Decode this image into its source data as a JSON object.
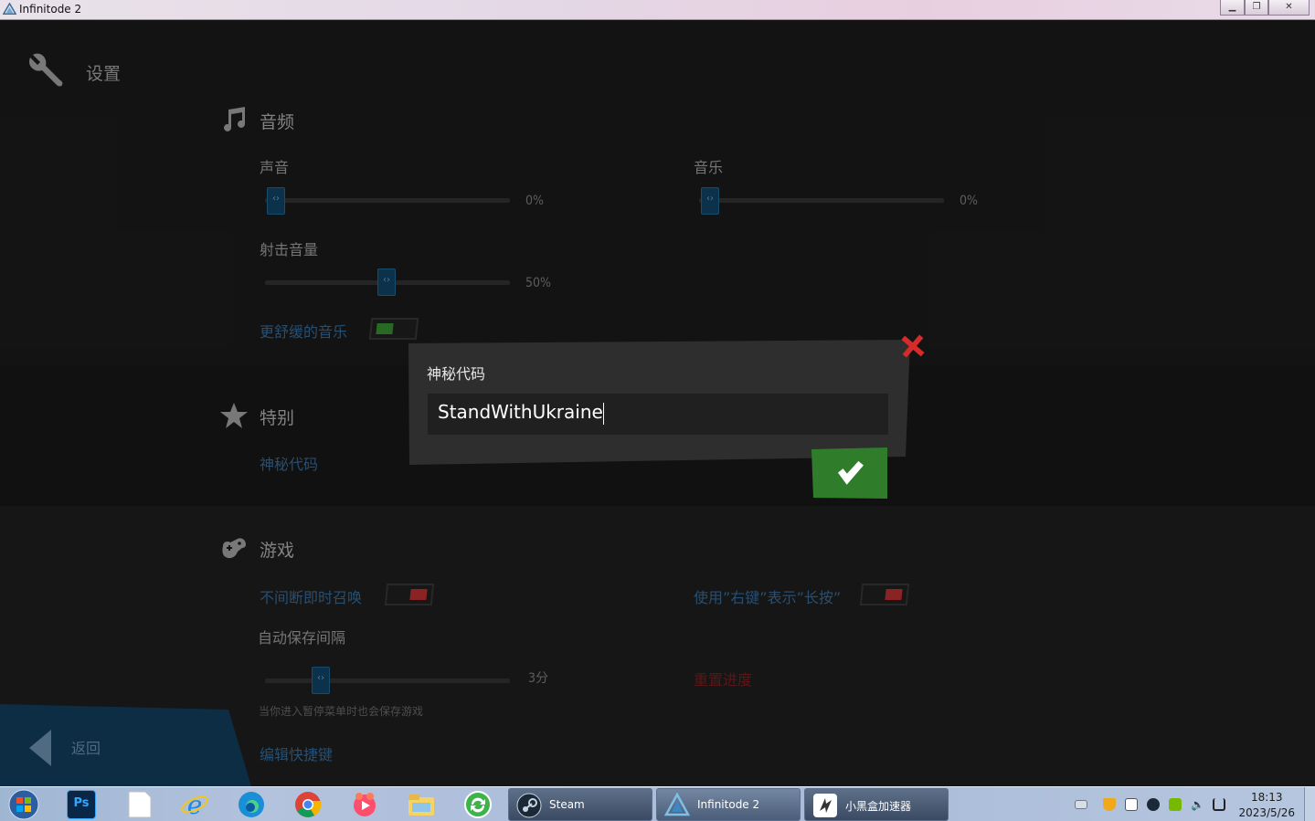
{
  "window": {
    "title": "Infinitode 2",
    "buttons": [
      "minimize",
      "restore",
      "close"
    ]
  },
  "page": {
    "title": "设置"
  },
  "audio": {
    "section_title": "音频",
    "sound_label": "声音",
    "sound_value": "0%",
    "sound_level": 0,
    "music_label": "音乐",
    "music_value": "0%",
    "music_level": 0,
    "shot_label": "射击音量",
    "shot_value": "50%",
    "shot_level": 0.5,
    "calm_music_label": "更舒缓的音乐",
    "calm_music_on": true
  },
  "special": {
    "section_title": "特别",
    "secret_code_link": "神秘代码"
  },
  "game": {
    "section_title": "游戏",
    "instant_call_label": "不间断即时召唤",
    "instant_call_on": false,
    "right_click_label": "使用”右键”表示”长按”",
    "right_click_on": false,
    "autosave_label": "自动保存间隔",
    "autosave_value": "3分",
    "autosave_note": "当你进入暂停菜单时也会保存游戏",
    "reset_progress": "重置进度",
    "edit_hotkeys": "编辑快捷键"
  },
  "back_button": {
    "label": "返回"
  },
  "dialog": {
    "title": "神秘代码",
    "input_value": "StandWithUkraine",
    "confirm_icon": "checkmark-icon",
    "close_icon": "close-x-icon"
  },
  "taskbar": {
    "pinned": [
      "windows-start-icon",
      "photoshop-icon",
      "blank-file-icon",
      "internet-explorer-icon",
      "edge-icon",
      "chrome-icon",
      "app-icon",
      "file-explorer-icon",
      "refresh-app-icon"
    ],
    "photoshop_label": "Ps",
    "tasks": [
      {
        "label": "Steam",
        "icon": "steam-icon"
      },
      {
        "label": "Infinitode 2",
        "icon": "infinitode-icon"
      },
      {
        "label": "小黑盒加速器",
        "icon": "accelerator-icon"
      }
    ],
    "clock_time": "18:13",
    "clock_date": "2023/5/26"
  },
  "colors": {
    "accent_blue": "#2f5d85",
    "toggle_on": "#2f7d2b",
    "toggle_off": "#a52a2a",
    "close_red": "#d62b2b",
    "confirm_green": "#2f7d2b"
  }
}
